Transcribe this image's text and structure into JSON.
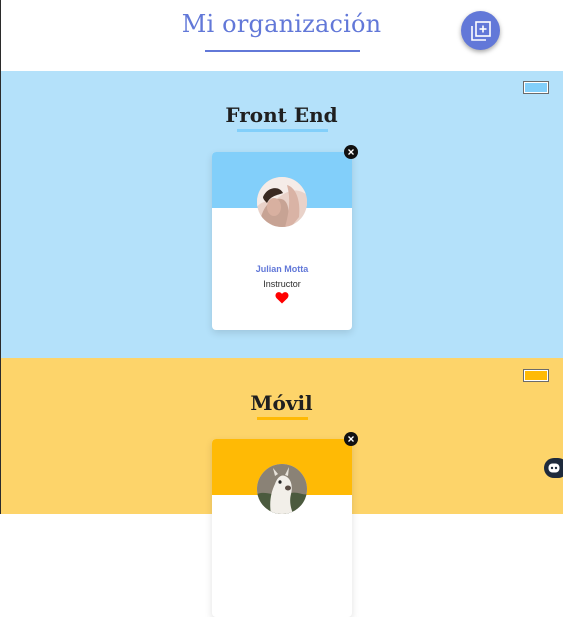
{
  "header": {
    "title": "Mi organización",
    "add_button_icon": "add-team-icon"
  },
  "teams": [
    {
      "name": "Front End",
      "primary_color": "#b4e1fa",
      "secondary_color": "#82cffa",
      "members": [
        {
          "name": "Julian Motta",
          "role": "Instructor",
          "favorite": true
        }
      ]
    },
    {
      "name": "Móvil",
      "primary_color": "#fdd46a",
      "secondary_color": "#ffba05",
      "members": [
        {
          "name": "",
          "role": "",
          "favorite": false
        }
      ]
    }
  ],
  "colors": {
    "accent": "#6278d8",
    "favorite": "#ff0000"
  },
  "widgets": {
    "chat_icon": "chat-bot-icon"
  }
}
